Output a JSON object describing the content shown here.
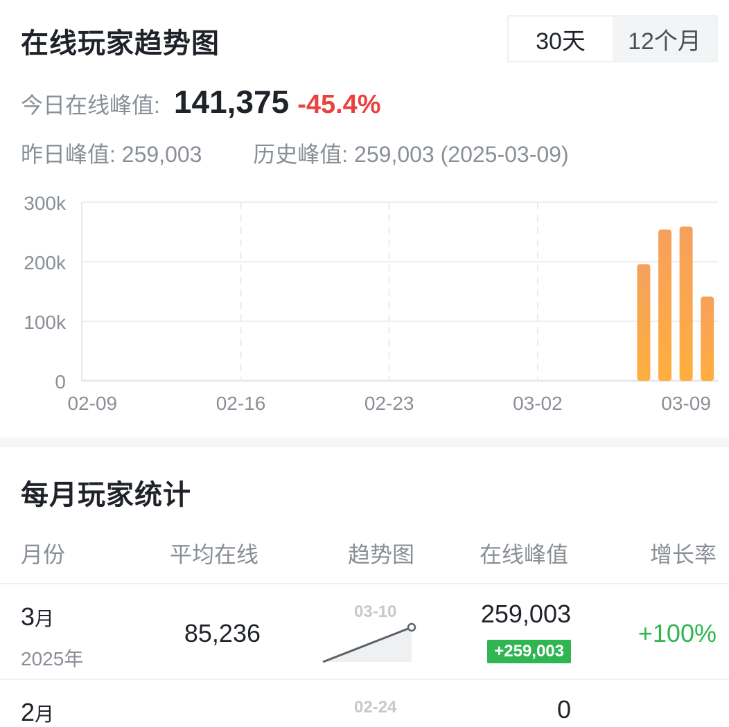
{
  "header": {
    "title": "在线玩家趋势图",
    "range_tabs": [
      {
        "label": "30天",
        "active": true
      },
      {
        "label": "12个月",
        "active": false
      }
    ]
  },
  "today": {
    "label": "今日在线峰值:",
    "value": "141,375",
    "change": "-45.4%",
    "change_color": "#e8423f"
  },
  "history": {
    "yesterday_label": "昨日峰值:",
    "yesterday_value": "259,003",
    "alltime_label": "历史峰值:",
    "alltime_value": "259,003 (2025-03-09)"
  },
  "chart_data": {
    "type": "bar",
    "x_tick_labels": [
      "02-09",
      "02-16",
      "02-23",
      "03-02",
      "03-09"
    ],
    "y_tick_labels": [
      "0",
      "100k",
      "200k",
      "300k"
    ],
    "ylim": [
      0,
      300000
    ],
    "grid": true,
    "bar_color": "#ffa24c",
    "x_start": "2025-02-09",
    "x_end": "2025-03-10",
    "points": [
      {
        "x": "2025-03-07",
        "y": 196000
      },
      {
        "x": "2025-03-08",
        "y": 254000
      },
      {
        "x": "2025-03-09",
        "y": 259003
      },
      {
        "x": "2025-03-10",
        "y": 141375
      }
    ]
  },
  "monthly": {
    "title": "每月玩家统计",
    "columns": [
      "月份",
      "平均在线",
      "趋势图",
      "在线峰值",
      "增长率"
    ],
    "rows": [
      {
        "month": "3",
        "month_unit": "月",
        "year": "2025年",
        "avg": "85,236",
        "spark_label": "03-10",
        "peak": "259,003",
        "peak_delta": "+259,003",
        "growth": "+100%"
      },
      {
        "month": "2",
        "month_unit": "月",
        "year": "",
        "avg": "",
        "spark_label": "02-24",
        "peak": "0",
        "peak_delta": "",
        "growth": ""
      }
    ]
  }
}
